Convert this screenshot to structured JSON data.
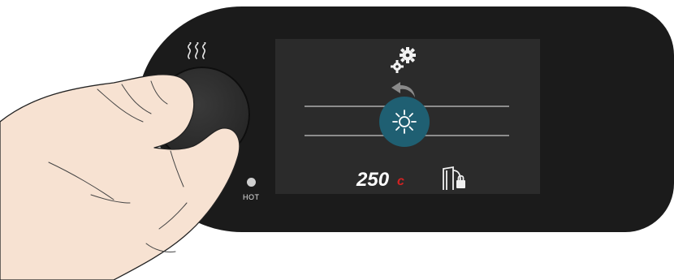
{
  "panel": {
    "indicator_label": "HOT",
    "icons": {
      "heat": "heat-waves-icon",
      "settings": "gears-icon",
      "back": "back-arrow-icon",
      "light": "light-sun-icon",
      "door_lock": "door-lock-icon"
    }
  },
  "screen": {
    "temperature_value": "250",
    "temperature_unit": "c",
    "selected_item": "light"
  },
  "colors": {
    "body": "#1b1b1b",
    "screen": "#2b2b2b",
    "highlight": "#1f5f72",
    "unit_red": "#d32222",
    "indicator": "#cfcfcf"
  }
}
